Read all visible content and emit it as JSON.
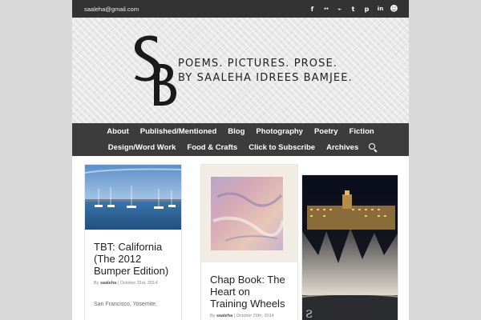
{
  "topbar": {
    "email": "saaleha@gmail.com",
    "social_icons": [
      "facebook-icon",
      "flickr-icon",
      "rss-icon",
      "twitter-icon",
      "pinterest-icon",
      "linkedin-icon",
      "smiley-icon"
    ],
    "social_glyphs": [
      "f",
      "••",
      "⌁",
      "t",
      "p",
      "in",
      "☻"
    ]
  },
  "header": {
    "tagline_line1": "POEMS. PICTURES. PROSE.",
    "tagline_line2": "BY SAALEHA IDREES BAMJEE."
  },
  "nav": {
    "row1": [
      "About",
      "Published/Mentioned",
      "Blog",
      "Photography",
      "Poetry",
      "Fiction"
    ],
    "row2": [
      "Design/Word Work",
      "Food & Crafts",
      "Click to Subscribe",
      "Archives"
    ]
  },
  "posts": [
    {
      "title": "TBT: California (The 2012 Bumper Edition)",
      "by": "By",
      "author": "saaleha",
      "date": "October 31st, 2014",
      "excerpt": "San Francisco, Yosemite,"
    },
    {
      "title": "Chap Book: The Heart on Training Wheels",
      "by": "By",
      "author": "saaleha",
      "date": "October 29th, 2014"
    }
  ],
  "colors": {
    "topbar": "#333333",
    "nav": "#3c3c3c",
    "page_bg": "#d9d9d9"
  }
}
